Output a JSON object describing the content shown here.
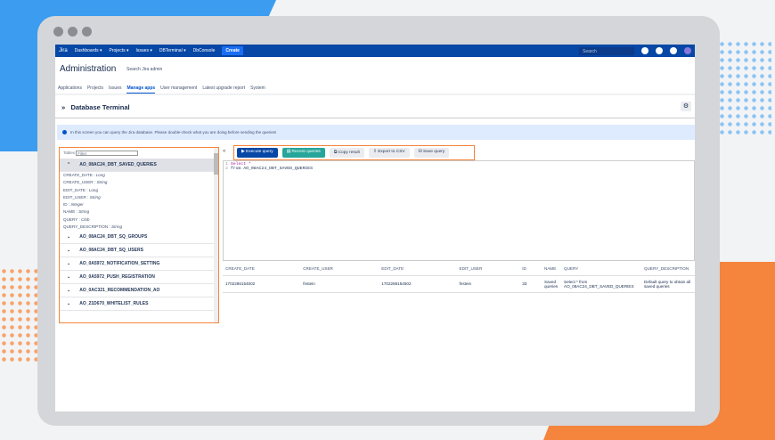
{
  "nav": {
    "logo": "Jira",
    "items": [
      "Dashboards ▾",
      "Projects ▾",
      "Issues ▾",
      "DBTerminal ▾",
      "DbConsole"
    ],
    "create": "Create",
    "search_placeholder": "Search"
  },
  "header": {
    "title": "Administration",
    "search": "Search Jira admin"
  },
  "tabs": [
    "Applications",
    "Projects",
    "Issues",
    "Manage apps",
    "User management",
    "Latest upgrade report",
    "System"
  ],
  "page_title": "Database Terminal",
  "info": "In this screen you can query the Jira database. Please double-check what you are doing before sending the queries!",
  "tables_panel": {
    "label": "Tables",
    "filter_placeholder": "Filter",
    "open_table": "AO_08AC24_DBT_SAVED_QUERIES",
    "columns": [
      {
        "n": "CREATE_DATE",
        "t": "Long"
      },
      {
        "n": "CREATE_USER",
        "t": "String"
      },
      {
        "n": "EDIT_DATE",
        "t": "Long"
      },
      {
        "n": "EDIT_USER",
        "t": "String"
      },
      {
        "n": "ID",
        "t": "Integer"
      },
      {
        "n": "NAME",
        "t": "String"
      },
      {
        "n": "QUERY",
        "t": "Clob"
      },
      {
        "n": "QUERY_DESCRIPTION",
        "t": "String"
      }
    ],
    "tables": [
      "AO_08AC24_DBT_SQ_GROUPS",
      "AO_08AC24_DBT_SQ_USERS",
      "AO_0A5972_NOTIFICATION_SETTING",
      "AO_0A5972_PUSH_REGISTRATION",
      "AO_0AC321_RECOMMENDATION_AO",
      "AO_21D670_WHITELIST_RULES"
    ]
  },
  "toolbar": {
    "execute": "▶ Execute query",
    "recent": "▤ Recent queries",
    "copy": "⧉ Copy result",
    "export": "⇪ Export to CSV",
    "save": "⛁ Save query"
  },
  "editor": {
    "lines": [
      "Select *",
      "from AO_08AC24_DBT_SAVED_QUERIES"
    ]
  },
  "results": {
    "headers": [
      "CREATE_DATE",
      "CREATE_USER",
      "EDIT_DATE",
      "EDIT_USER",
      "ID",
      "NAME",
      "QUERY",
      "QUERY_DESCRIPTION"
    ],
    "rows": [
      [
        "1702286154502",
        "fnstein",
        "1702286154502",
        "fnstein",
        "33",
        "Saved queries",
        "Select * from AO_08AC24_DBT_SAVED_QUERIES",
        "Default query to obtain all saved queries"
      ]
    ]
  }
}
